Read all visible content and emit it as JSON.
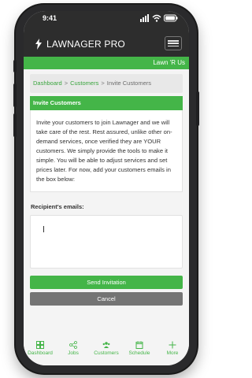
{
  "status": {
    "time": "9:41"
  },
  "app": {
    "title": "LAWNAGER PRO",
    "account": "Lawn 'R Us"
  },
  "breadcrumb": {
    "items": [
      "Dashboard",
      "Customers",
      "Invite Customers"
    ]
  },
  "invite": {
    "heading": "Invite Customers",
    "body": "Invite your customers to join Lawnager and we will take care of the rest. Rest assured, unlike other on-demand services, once verified they are YOUR customers. We simply provide the tools to make it simple. You will be able to adjust services and set prices later. For now, add your customers emails in the box below:"
  },
  "recipients": {
    "label": "Recipient's emails:",
    "value": ""
  },
  "buttons": {
    "send": "Send Invitation",
    "cancel": "Cancel"
  },
  "tabs": [
    {
      "label": "Dashboard",
      "icon": "dashboard-icon"
    },
    {
      "label": "Jobs",
      "icon": "jobs-icon"
    },
    {
      "label": "Customers",
      "icon": "customers-icon"
    },
    {
      "label": "Schedule",
      "icon": "calendar-icon"
    },
    {
      "label": "More",
      "icon": "plus-icon"
    }
  ],
  "colors": {
    "brand_green": "#44b548",
    "appbar": "#2d2d2d",
    "cancel_gray": "#747474"
  }
}
